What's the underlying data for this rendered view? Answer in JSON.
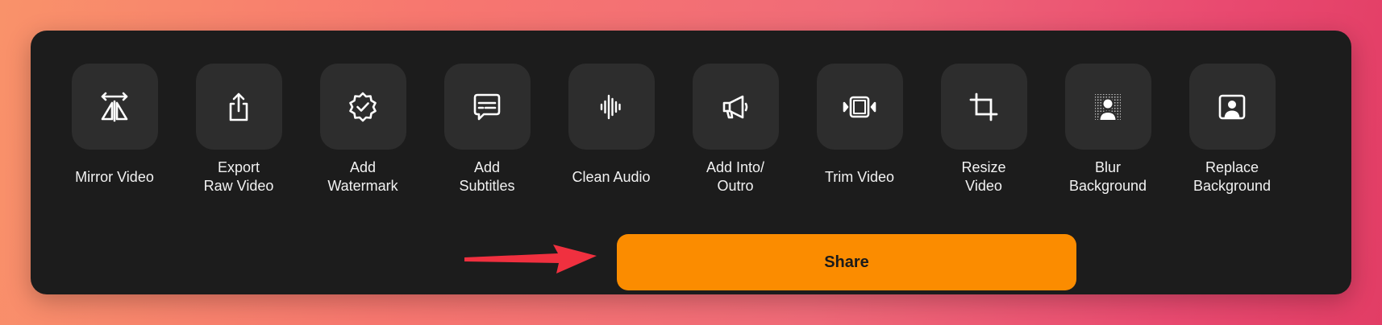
{
  "tools": [
    {
      "label": "Mirror Video",
      "icon": "mirror-icon"
    },
    {
      "label": "Export\nRaw Video",
      "icon": "export-icon"
    },
    {
      "label": "Add\nWatermark",
      "icon": "badge-check-icon"
    },
    {
      "label": "Add\nSubtitles",
      "icon": "subtitles-icon"
    },
    {
      "label": "Clean Audio",
      "icon": "waveform-icon"
    },
    {
      "label": "Add Into/\nOutro",
      "icon": "megaphone-icon"
    },
    {
      "label": "Trim Video",
      "icon": "trim-icon"
    },
    {
      "label": "Resize\nVideo",
      "icon": "crop-icon"
    },
    {
      "label": "Blur\nBackground",
      "icon": "blur-person-icon"
    },
    {
      "label": "Replace\nBackground",
      "icon": "person-frame-icon"
    }
  ],
  "share": {
    "label": "Share"
  },
  "colors": {
    "panel": "#1c1c1c",
    "tile": "#2d2d2d",
    "share_button": "#fb8c00",
    "arrow": "#f0303f"
  }
}
